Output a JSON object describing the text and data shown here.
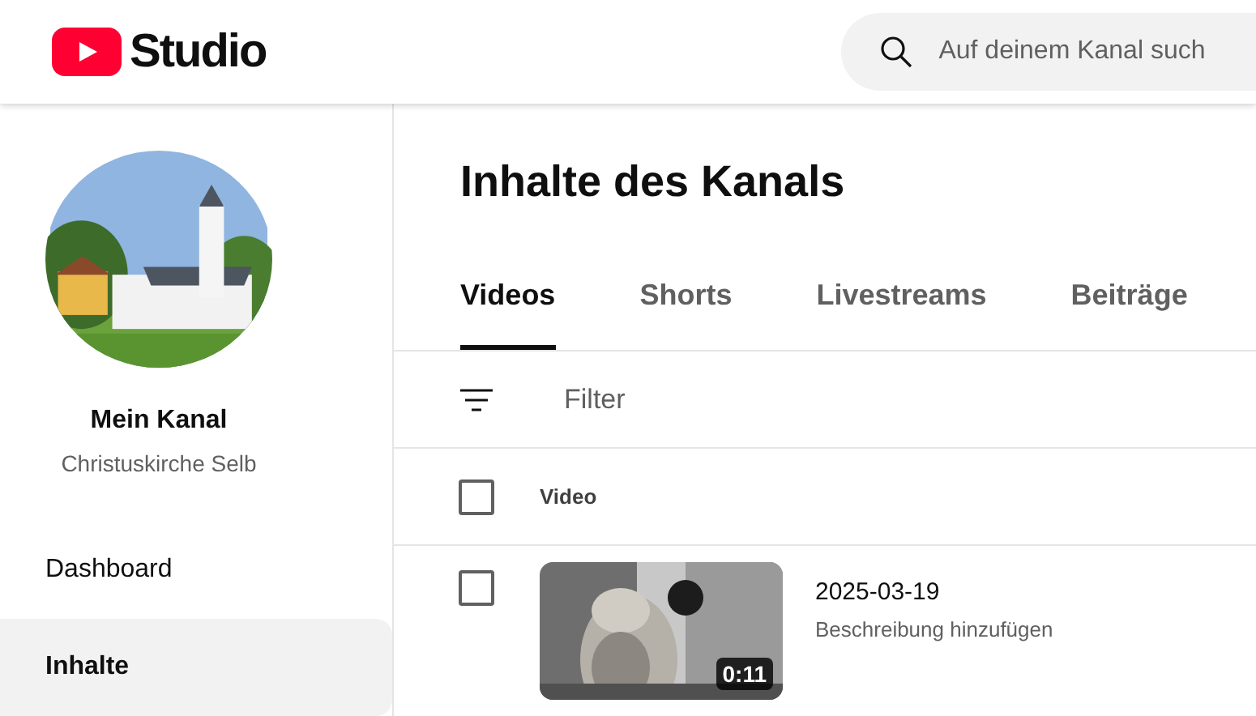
{
  "header": {
    "logo": "Studio",
    "search": {
      "placeholder": "Auf deinem Kanal such"
    }
  },
  "sidebar": {
    "channel_name": "Mein Kanal",
    "channel_subtitle": "Christuskirche Selb",
    "items": [
      {
        "label": "Dashboard",
        "selected": false
      },
      {
        "label": "Inhalte",
        "selected": true
      }
    ]
  },
  "main": {
    "title": "Inhalte des Kanals",
    "tabs": [
      {
        "label": "Videos",
        "selected": true
      },
      {
        "label": "Shorts",
        "selected": false
      },
      {
        "label": "Livestreams",
        "selected": false
      },
      {
        "label": "Beiträge",
        "selected": false
      }
    ],
    "filter": {
      "placeholder": "Filter"
    },
    "table": {
      "select_all_checked": false,
      "columns": [
        "Video"
      ],
      "rows": [
        {
          "checked": false,
          "title": "2025-03-19",
          "description": "Beschreibung hinzufügen",
          "duration": "0:11"
        }
      ]
    }
  }
}
